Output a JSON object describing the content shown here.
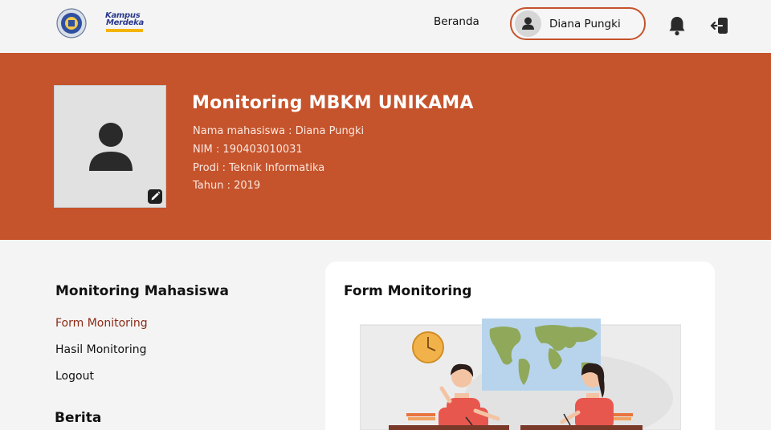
{
  "header": {
    "logos": {
      "university": "university-logo",
      "kampus_merdeka": "kampus-merdeka-logo",
      "km_line1": "Kampus",
      "km_line2": "Merdeka"
    },
    "nav_home": "Beranda",
    "user_name": "Diana Pungki",
    "icons": {
      "user": "user-icon",
      "bell": "bell-icon",
      "logout": "logout-icon"
    }
  },
  "hero": {
    "title": "Monitoring MBKM UNIKAMA",
    "info": [
      "Nama mahasiswa : Diana Pungki",
      "NIM : 190403010031",
      "Prodi : Teknik Informatika",
      "Tahun : 2019"
    ],
    "icons": {
      "photo": "profile-placeholder-icon",
      "edit": "pencil-icon"
    }
  },
  "sidebar": {
    "title": "Monitoring Mahasiswa",
    "links": [
      "Form Monitoring",
      "Hasil Monitoring",
      "Logout"
    ],
    "active_index": 0,
    "news_title": "Berita"
  },
  "card": {
    "title": "Form Monitoring",
    "illustration": "classroom-illustration"
  },
  "colors": {
    "accent": "#c5532b",
    "active_link": "#8c2a16",
    "background": "#f4f4f4"
  }
}
